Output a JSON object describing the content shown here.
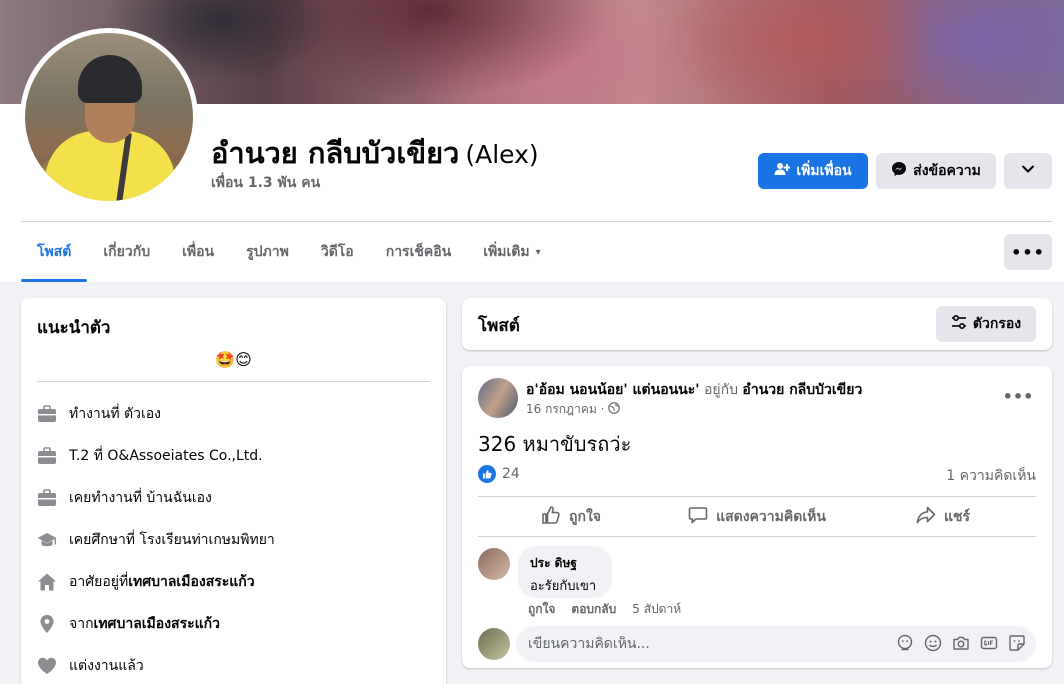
{
  "profile": {
    "name": "อำนวย กลีบบัวเขียว",
    "alt_name": "(Alex)",
    "friends": "เพื่อน 1.3 พัน คน",
    "add_friend": "เพิ่มเพื่อน",
    "message": "ส่งข้อความ",
    "colors": {
      "primary": "#1b74e4",
      "gray_button": "#e4e6eb"
    }
  },
  "tabs": [
    {
      "label": "โพสต์",
      "active": true
    },
    {
      "label": "เกี่ยวกับ"
    },
    {
      "label": "เพื่อน"
    },
    {
      "label": "รูปภาพ"
    },
    {
      "label": "วิดีโอ"
    },
    {
      "label": "การเช็คอิน"
    },
    {
      "label": "เพิ่มเติม",
      "caret": "▾"
    }
  ],
  "tabs_more": "•••",
  "intro": {
    "title": "แนะนำตัว",
    "bio": "🤩😊",
    "items": [
      {
        "icon": "briefcase-icon",
        "text": "ทำงานที่ ตัวเอง",
        "bold": ""
      },
      {
        "icon": "briefcase-icon",
        "text": "T.2 ที่ O&Assoeiates Co.,Ltd.",
        "bold": ""
      },
      {
        "icon": "briefcase-icon",
        "text": "เคยทำงานที่ บ้านฉันเอง",
        "bold": ""
      },
      {
        "icon": "graduation-cap-icon",
        "text": "เคยศึกษาที่ โรงเรียนท่าเกษมพิทยา",
        "bold": ""
      },
      {
        "icon": "home-icon",
        "text": "อาศัยอยู่ที่ ",
        "bold": "เทศบาลเมืองสระแก้ว"
      },
      {
        "icon": "location-pin-icon",
        "text": "จาก ",
        "bold": "เทศบาลเมืองสระแก้ว"
      },
      {
        "icon": "heart-icon",
        "text": "แต่งงานแล้ว",
        "bold": ""
      }
    ]
  },
  "posts_header": {
    "title": "โพสต์",
    "filter": "ตัวกรอง"
  },
  "post": {
    "author": "อ'อ้อม นอนน้อย' แต่นอนนะ'",
    "with_text": " อยู่กับ ",
    "with_name": "อำนวย กลีบบัวเขียว",
    "date": "16 กรกฎาคม ·",
    "dots": "•••",
    "text": "326 หมาขับรถว่ะ",
    "likes": "24",
    "comments_count": "1 ความคิดเห็น",
    "actions": {
      "like": "ถูกใจ",
      "comment": "แสดงความคิดเห็น",
      "share": "แชร์"
    },
    "comment": {
      "name": "ประ ดิษฐ",
      "text": "อะรัยกับเขา",
      "like": "ถูกใจ",
      "reply": "ตอบกลับ",
      "time": "5 สัปดาห์"
    },
    "write_placeholder": "เขียนความคิดเห็น..."
  }
}
